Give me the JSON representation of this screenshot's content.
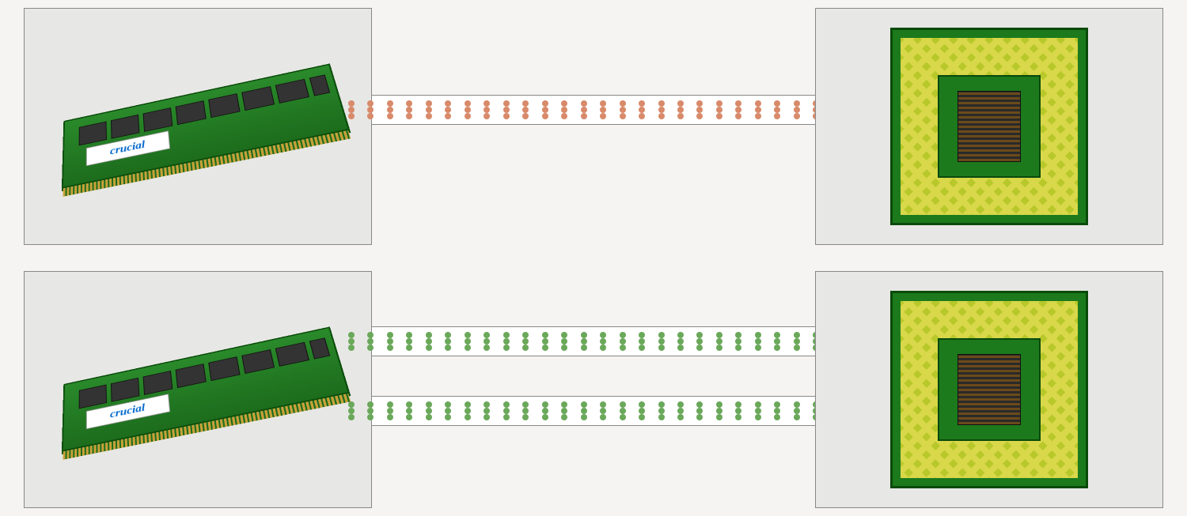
{
  "diagram": {
    "rows": [
      {
        "id": "single-channel",
        "ram_brand": "crucial",
        "pipes": 1,
        "dot_color": "orange",
        "dots_per_row": 26,
        "dot_rows_per_pipe": 3
      },
      {
        "id": "dual-channel",
        "ram_brand": "crucial",
        "pipes": 2,
        "dot_color": "green",
        "dots_per_row": 26,
        "dot_rows_per_pipe": 3
      }
    ],
    "ram_chip_count": 8
  }
}
